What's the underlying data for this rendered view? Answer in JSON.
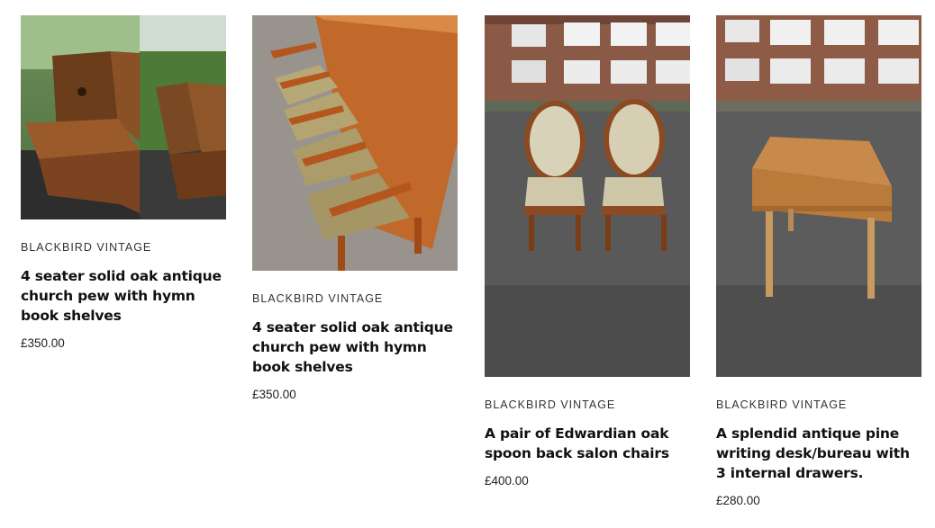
{
  "products": [
    {
      "vendor": "BLACKBIRD VINTAGE",
      "title": "4 seater solid oak antique church pew with hymn book shelves",
      "price": "£350.00",
      "image_subject": "church-pew-outdoor-photo"
    },
    {
      "vendor": "BLACKBIRD VINTAGE",
      "title": "4 seater solid oak antique church pew with hymn book shelves",
      "price": "£350.00",
      "image_subject": "church-pew-upholstered-photo"
    },
    {
      "vendor": "BLACKBIRD VINTAGE",
      "title": "A pair of Edwardian oak spoon back salon chairs",
      "price": "£400.00",
      "image_subject": "salon-chairs-photo"
    },
    {
      "vendor": "BLACKBIRD VINTAGE",
      "title": "A splendid antique pine writing desk/bureau with 3 internal drawers.",
      "price": "£280.00",
      "image_subject": "pine-writing-desk-photo"
    }
  ],
  "colors": {
    "text": "#111111",
    "vendor_text": "#333333",
    "background": "#ffffff"
  }
}
